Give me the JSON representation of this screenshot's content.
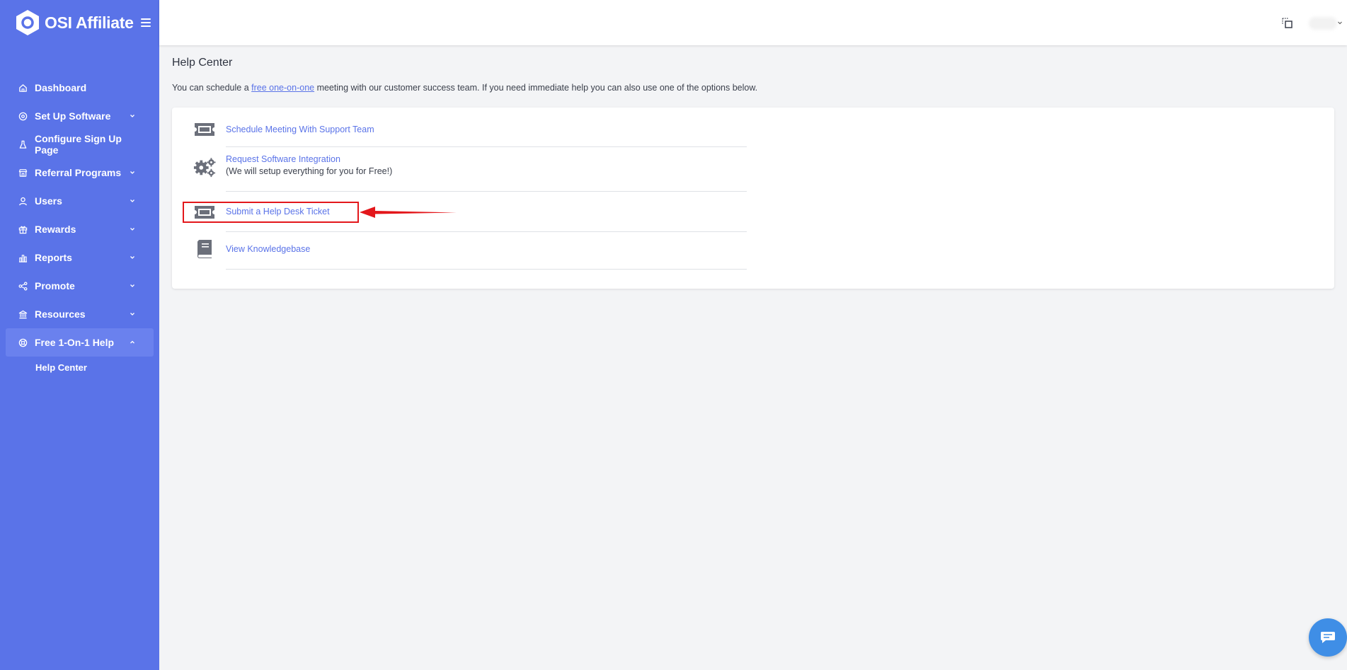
{
  "brand": {
    "name": "OSI Affiliate"
  },
  "sidebar": {
    "items": [
      {
        "label": "Dashboard",
        "icon": "home-icon",
        "has_children": false
      },
      {
        "label": "Set Up Software",
        "icon": "settings-icon",
        "has_children": true
      },
      {
        "label": "Configure Sign Up Page",
        "icon": "flask-icon",
        "has_children": false
      },
      {
        "label": "Referral Programs",
        "icon": "store-icon",
        "has_children": true
      },
      {
        "label": "Users",
        "icon": "user-icon",
        "has_children": true
      },
      {
        "label": "Rewards",
        "icon": "gift-icon",
        "has_children": true
      },
      {
        "label": "Reports",
        "icon": "bar-chart-icon",
        "has_children": true
      },
      {
        "label": "Promote",
        "icon": "share-icon",
        "has_children": true
      },
      {
        "label": "Resources",
        "icon": "bank-icon",
        "has_children": true
      },
      {
        "label": "Free 1-On-1 Help",
        "icon": "lifebuoy-icon",
        "has_children": true,
        "expanded": true
      }
    ],
    "subitems": [
      {
        "label": "Help Center"
      }
    ]
  },
  "main": {
    "title": "Help Center",
    "intro_before": "You can schedule a ",
    "intro_link": "free one-on-one",
    "intro_after": " meeting with our customer success team. If you need immediate help you can also use one of the options below.",
    "options": [
      {
        "title": "Schedule Meeting With Support Team",
        "subtitle": "",
        "icon": "ticket-icon"
      },
      {
        "title": "Request Software Integration",
        "subtitle": "(We will setup everything for you for Free!)",
        "icon": "gears-icon"
      },
      {
        "title": "Submit a Help Desk Ticket",
        "subtitle": "",
        "icon": "ticket-icon"
      },
      {
        "title": "View Knowledgebase",
        "subtitle": "",
        "icon": "book-icon"
      }
    ]
  },
  "colors": {
    "sidebar": "#5a73e8",
    "link": "#5a73e8",
    "highlight": "#e3171b",
    "chat": "#3f8ee6"
  }
}
